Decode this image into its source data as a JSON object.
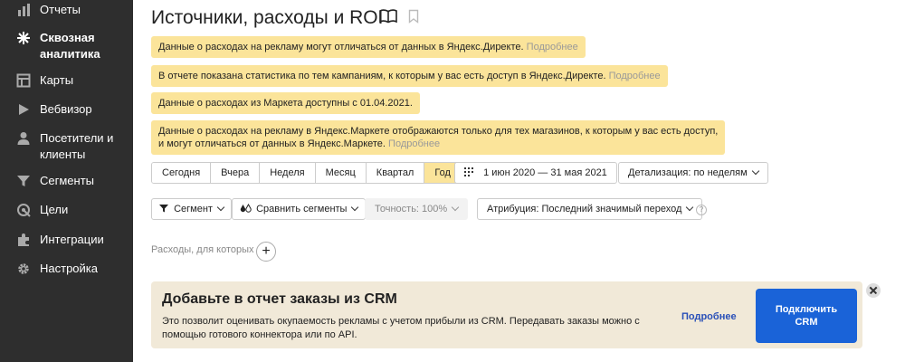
{
  "sidebar": {
    "items": [
      {
        "label": "Отчеты",
        "icon": "bar-chart-icon"
      },
      {
        "label": "Сквозная аналитика",
        "icon": "asterisk-icon",
        "active": true
      },
      {
        "label": "Карты",
        "icon": "grid-map-icon"
      },
      {
        "label": "Вебвизор",
        "icon": "play-icon"
      },
      {
        "label": "Посетители и клиенты",
        "icon": "person-icon"
      },
      {
        "label": "Сегменты",
        "icon": "funnel-icon"
      },
      {
        "label": "Цели",
        "icon": "target-icon"
      },
      {
        "label": "Интеграции",
        "icon": "puzzle-icon"
      },
      {
        "label": "Настройка",
        "icon": "gear-icon"
      }
    ]
  },
  "page": {
    "title": "Источники, расходы и ROI"
  },
  "notices": [
    {
      "text": "Данные о расходах на рекламу могут отличаться от данных в Яндекс.Директе.",
      "more": "Подробнее"
    },
    {
      "text": "В отчете показана статистика по тем кампаниям, к которым у вас есть доступ в Яндекс.Директе.",
      "more": "Подробнее"
    },
    {
      "text": "Данные о расходах из Маркета доступны с 01.04.2021.",
      "more": ""
    },
    {
      "text": "Данные о расходах на рекламу в Яндекс.Маркете отображаются только для тех магазинов, к которым у вас есть доступ,",
      "text2": "и могут отличаться от данных в Яндекс.Маркете.",
      "more": "Подробнее"
    }
  ],
  "periods": [
    "Сегодня",
    "Вчера",
    "Неделя",
    "Месяц",
    "Квартал",
    "Год"
  ],
  "active_period": "Год",
  "date_range": "1 июн 2020 — 31 мая 2021",
  "detail": "Детализация: по неделям",
  "filters": {
    "segment": "Сегмент",
    "compare": "Сравнить сегменты",
    "accuracy": "Точность: 100%",
    "attribution": "Атрибуция: Последний значимый переход",
    "hint": "?"
  },
  "expenses_label": "Расходы, для которых",
  "crm": {
    "title": "Добавьте в отчет заказы из CRM",
    "desc": "Это позволит оценивать окупаемость рекламы с учетом прибыли из CRM. Передавать заказы можно с помощью готового коннектора или по API.",
    "more": "Подробнее",
    "connect_line1": "Подключить",
    "connect_line2": "CRM"
  },
  "colors": {
    "sidebar": "#2e2e2e",
    "notice": "#fbe49a",
    "accent_blue": "#1a63d8",
    "crm_bg": "#f1e9d8"
  }
}
